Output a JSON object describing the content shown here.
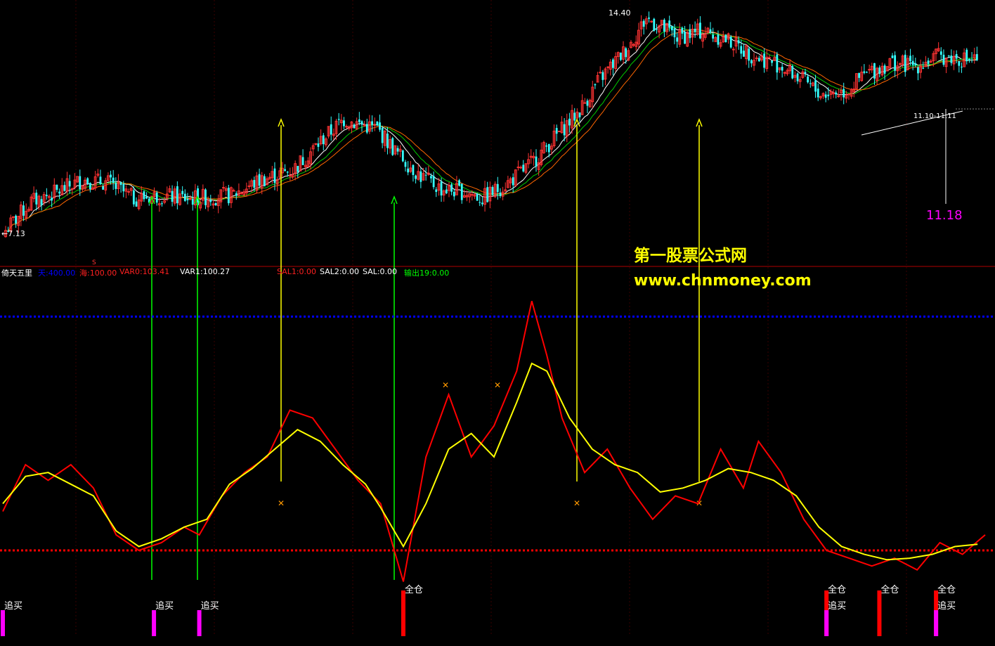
{
  "indicator": {
    "name": "倚天五里",
    "fields": [
      {
        "label": "天:400.00",
        "color": "#0000ff"
      },
      {
        "label": "海:100.00",
        "color": "#ff2020"
      },
      {
        "label": "VAR0:103.41",
        "color": "#ff2020"
      },
      {
        "label": "VAR1:100.27",
        "color": "#ffffff"
      },
      {
        "label": "SAL1:0.00",
        "color": "#ff2020"
      },
      {
        "label": "SAL2:0.00",
        "color": "#ffffff"
      },
      {
        "label": "SAL:0.00",
        "color": "#ffffff"
      },
      {
        "label": "输出19:0.00",
        "color": "#00ff00"
      }
    ]
  },
  "watermark": {
    "line1": "第一股票公式网",
    "line2": "www.chnmoney.com"
  },
  "price_labels": {
    "high": "14.40",
    "low": "←7.13",
    "current": "11.18",
    "trend": "11.10-11.11"
  },
  "signal_labels": {
    "chase": "追买",
    "full": "全仓",
    "sell_mark": "S"
  },
  "colors": {
    "up": "#ff3333",
    "down": "#33ffff",
    "ma1": "#ffffff",
    "ma2": "#00cc00",
    "ma3": "#ff6600",
    "osc_fast": "#ff0000",
    "osc_slow": "#ffff00",
    "upper_line": "#0000ff",
    "lower_line": "#ff0000",
    "buy_arrow": "#00ff00",
    "sell_arrow": "#ffff00",
    "signal_bar": "#ff00ff"
  },
  "chart_data": [
    {
      "type": "candlestick",
      "title": "",
      "price_range": [
        6.9,
        14.5
      ],
      "high_marker": 14.4,
      "low_marker": 7.13,
      "current_price": 11.18,
      "close_path": [
        [
          0,
          7.4
        ],
        [
          10,
          8.3
        ],
        [
          20,
          8.6
        ],
        [
          30,
          9.0
        ],
        [
          40,
          8.9
        ],
        [
          50,
          8.4
        ],
        [
          60,
          8.5
        ],
        [
          72,
          8.4
        ],
        [
          88,
          8.5
        ],
        [
          100,
          9.0
        ],
        [
          112,
          9.3
        ],
        [
          124,
          10.3
        ],
        [
          132,
          10.9
        ],
        [
          145,
          10.6
        ],
        [
          152,
          9.9
        ],
        [
          162,
          9.1
        ],
        [
          170,
          8.7
        ],
        [
          180,
          8.6
        ],
        [
          186,
          8.4
        ],
        [
          196,
          8.9
        ],
        [
          205,
          9.5
        ],
        [
          215,
          10.4
        ],
        [
          224,
          11.2
        ],
        [
          232,
          12.2
        ],
        [
          243,
          13.2
        ],
        [
          250,
          14.1
        ],
        [
          262,
          13.5
        ],
        [
          272,
          13.7
        ],
        [
          282,
          13.4
        ],
        [
          292,
          12.9
        ],
        [
          300,
          12.7
        ],
        [
          310,
          12.2
        ],
        [
          318,
          11.7
        ],
        [
          328,
          11.8
        ],
        [
          335,
          12.3
        ],
        [
          345,
          12.7
        ],
        [
          355,
          12.6
        ],
        [
          364,
          12.9
        ],
        [
          374,
          12.8
        ]
      ],
      "buy_signals_at": [
        40,
        52,
        107
      ],
      "sell_signals_at": [
        77,
        157,
        189
      ]
    },
    {
      "type": "line",
      "title": "",
      "y_range": [
        -10,
        450
      ],
      "upper_level": 400,
      "lower_level": 100,
      "series": [
        {
          "name": "",
          "color": "#ff0000",
          "values": [
            [
              0,
              150
            ],
            [
              6,
              210
            ],
            [
              12,
              190
            ],
            [
              18,
              210
            ],
            [
              24,
              180
            ],
            [
              30,
              120
            ],
            [
              36,
              100
            ],
            [
              42,
              110
            ],
            [
              48,
              130
            ],
            [
              52,
              120
            ],
            [
              58,
              170
            ],
            [
              64,
              200
            ],
            [
              70,
              220
            ],
            [
              76,
              280
            ],
            [
              82,
              270
            ],
            [
              88,
              230
            ],
            [
              94,
              190
            ],
            [
              100,
              160
            ],
            [
              106,
              60
            ],
            [
              112,
              220
            ],
            [
              118,
              300
            ],
            [
              124,
              220
            ],
            [
              130,
              260
            ],
            [
              136,
              330
            ],
            [
              140,
              420
            ],
            [
              144,
              350
            ],
            [
              148,
              270
            ],
            [
              154,
              200
            ],
            [
              160,
              230
            ],
            [
              166,
              180
            ],
            [
              172,
              140
            ],
            [
              178,
              170
            ],
            [
              184,
              160
            ],
            [
              190,
              230
            ],
            [
              196,
              180
            ],
            [
              200,
              240
            ],
            [
              206,
              200
            ],
            [
              212,
              140
            ],
            [
              218,
              100
            ],
            [
              224,
              90
            ],
            [
              230,
              80
            ],
            [
              236,
              90
            ],
            [
              242,
              75
            ],
            [
              248,
              110
            ],
            [
              254,
              95
            ],
            [
              260,
              120
            ]
          ]
        },
        {
          "name": "",
          "color": "#ffff00",
          "values": [
            [
              0,
              160
            ],
            [
              6,
              195
            ],
            [
              12,
              200
            ],
            [
              18,
              185
            ],
            [
              24,
              170
            ],
            [
              30,
              125
            ],
            [
              36,
              105
            ],
            [
              42,
              115
            ],
            [
              48,
              130
            ],
            [
              54,
              140
            ],
            [
              60,
              185
            ],
            [
              66,
              205
            ],
            [
              72,
              230
            ],
            [
              78,
              255
            ],
            [
              84,
              240
            ],
            [
              90,
              210
            ],
            [
              96,
              185
            ],
            [
              100,
              155
            ],
            [
              106,
              105
            ],
            [
              112,
              160
            ],
            [
              118,
              230
            ],
            [
              124,
              250
            ],
            [
              130,
              220
            ],
            [
              136,
              290
            ],
            [
              140,
              340
            ],
            [
              144,
              330
            ],
            [
              150,
              270
            ],
            [
              156,
              230
            ],
            [
              162,
              210
            ],
            [
              168,
              200
            ],
            [
              174,
              175
            ],
            [
              180,
              180
            ],
            [
              186,
              190
            ],
            [
              192,
              205
            ],
            [
              198,
              200
            ],
            [
              204,
              190
            ],
            [
              210,
              170
            ],
            [
              216,
              130
            ],
            [
              222,
              105
            ],
            [
              228,
              95
            ],
            [
              234,
              88
            ],
            [
              240,
              90
            ],
            [
              246,
              95
            ],
            [
              252,
              105
            ],
            [
              258,
              108
            ]
          ]
        }
      ],
      "signals": [
        {
          "label": "追买",
          "at": 0
        },
        {
          "label": "追买",
          "at": 40
        },
        {
          "label": "追买",
          "at": 52
        },
        {
          "label": "全仓",
          "at": 106
        },
        {
          "label": "全仓",
          "at": 218
        },
        {
          "label": "追买",
          "at": 218
        },
        {
          "label": "全仓",
          "at": 232
        },
        {
          "label": "全仓",
          "at": 247
        },
        {
          "label": "追买",
          "at": 247
        }
      ]
    }
  ]
}
